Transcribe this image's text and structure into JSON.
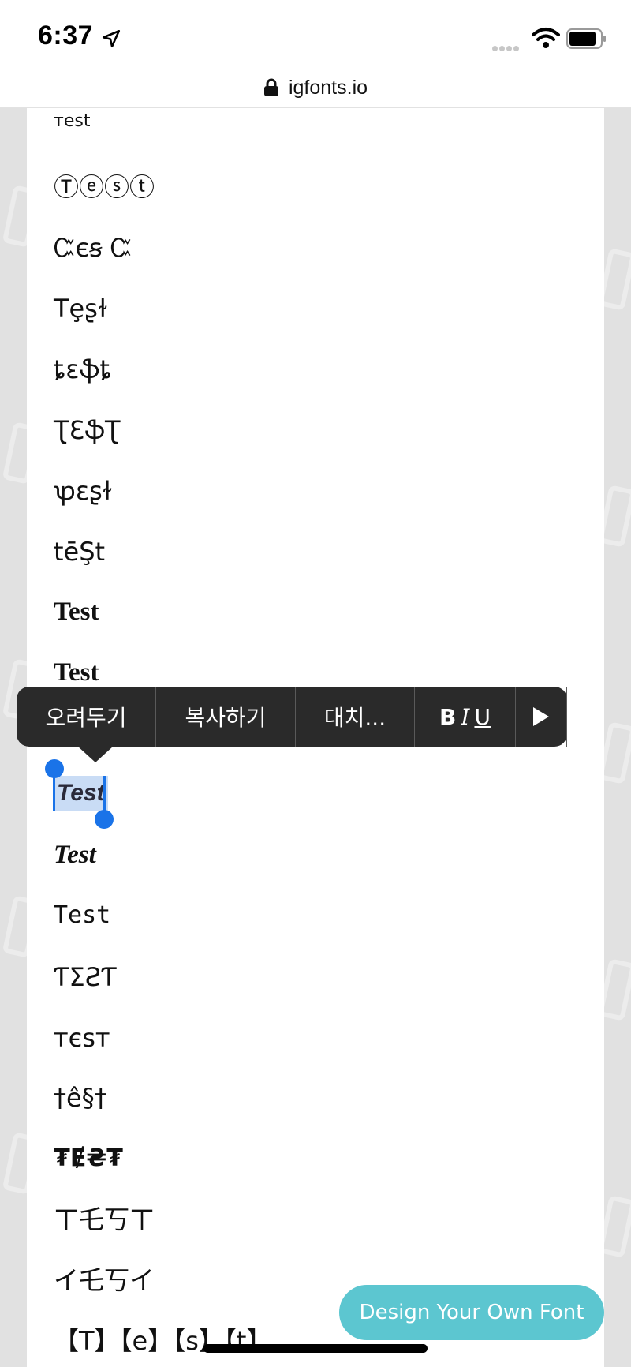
{
  "status_bar": {
    "time": "6:37",
    "location_icon": "location-arrow-icon",
    "signal_icon": "cellular-signal-icon",
    "wifi_icon": "wifi-icon",
    "battery_icon": "battery-icon"
  },
  "browser": {
    "url": "igfonts.io",
    "lock_icon": "lock-icon"
  },
  "font_samples": [
    "ᴛest",
    "Ⓣⓔⓢⓣ",
    "Ꮸєꞩ Ꮸ",
    "Tȩʂɫ",
    "ȶɛֆȶ",
    "ƮƐֆƮ",
    "ꝕɛʂɫ",
    "tēŞt",
    "Test",
    "Test",
    "Test",
    "Test",
    "Test",
    "ƬƩƧƬ",
    "ᴛєѕᴛ",
    "†ê§†",
    "₮Ɇ₴₮",
    "ㄒ乇丂ㄒ",
    "イ乇丂イ",
    "【T】【e】【s】【t】"
  ],
  "selected_text": "Test",
  "context_menu": {
    "paste": "오려두기",
    "copy": "복사하기",
    "replace": "대치...",
    "format_bold": "B",
    "format_italic": "I",
    "format_underline": "U",
    "more_icon": "play-arrow-icon"
  },
  "cta_button": "Design Your Own Font",
  "colors": {
    "accent": "#5cc6d0",
    "selection": "#1a73e8",
    "menu_bg": "#2a2a2a"
  }
}
